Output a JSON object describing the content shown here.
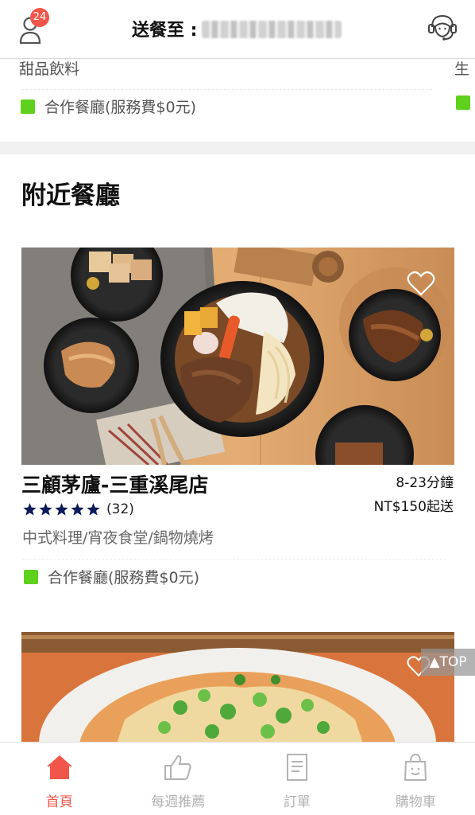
{
  "header": {
    "badge_count": "24",
    "deliver_label": "送餐至 :",
    "icons": {
      "user": "user-icon",
      "support": "headset-icon"
    }
  },
  "top_carousel": {
    "category_label": "甜品飲料",
    "category_label_next": "生",
    "partner_text": "合作餐廳(服務費$0元)"
  },
  "section": {
    "title": "附近餐廳"
  },
  "restaurant": {
    "name": "三顧茅廬-三重溪尾店",
    "delivery_time": "8-23分鐘",
    "min_order": "NT$150起送",
    "rating": 5,
    "review_count": "(32)",
    "cuisine": "中式料理/宵夜食堂/鍋物燒烤",
    "partner_text": "合作餐廳(服務費$0元)"
  },
  "back_to_top": "▲TOP",
  "bottom_nav": {
    "items": [
      {
        "label": "首頁",
        "icon": "home-icon",
        "active": true
      },
      {
        "label": "每週推薦",
        "icon": "thumbs-up-icon",
        "active": false
      },
      {
        "label": "訂單",
        "icon": "document-icon",
        "active": false
      },
      {
        "label": "購物車",
        "icon": "shopping-bag-icon",
        "active": false
      }
    ]
  },
  "colors": {
    "accent": "#f2564a",
    "partner_green": "#5fd11c",
    "star": "#0d1a5c",
    "inactive_nav": "#b3b3b3"
  }
}
